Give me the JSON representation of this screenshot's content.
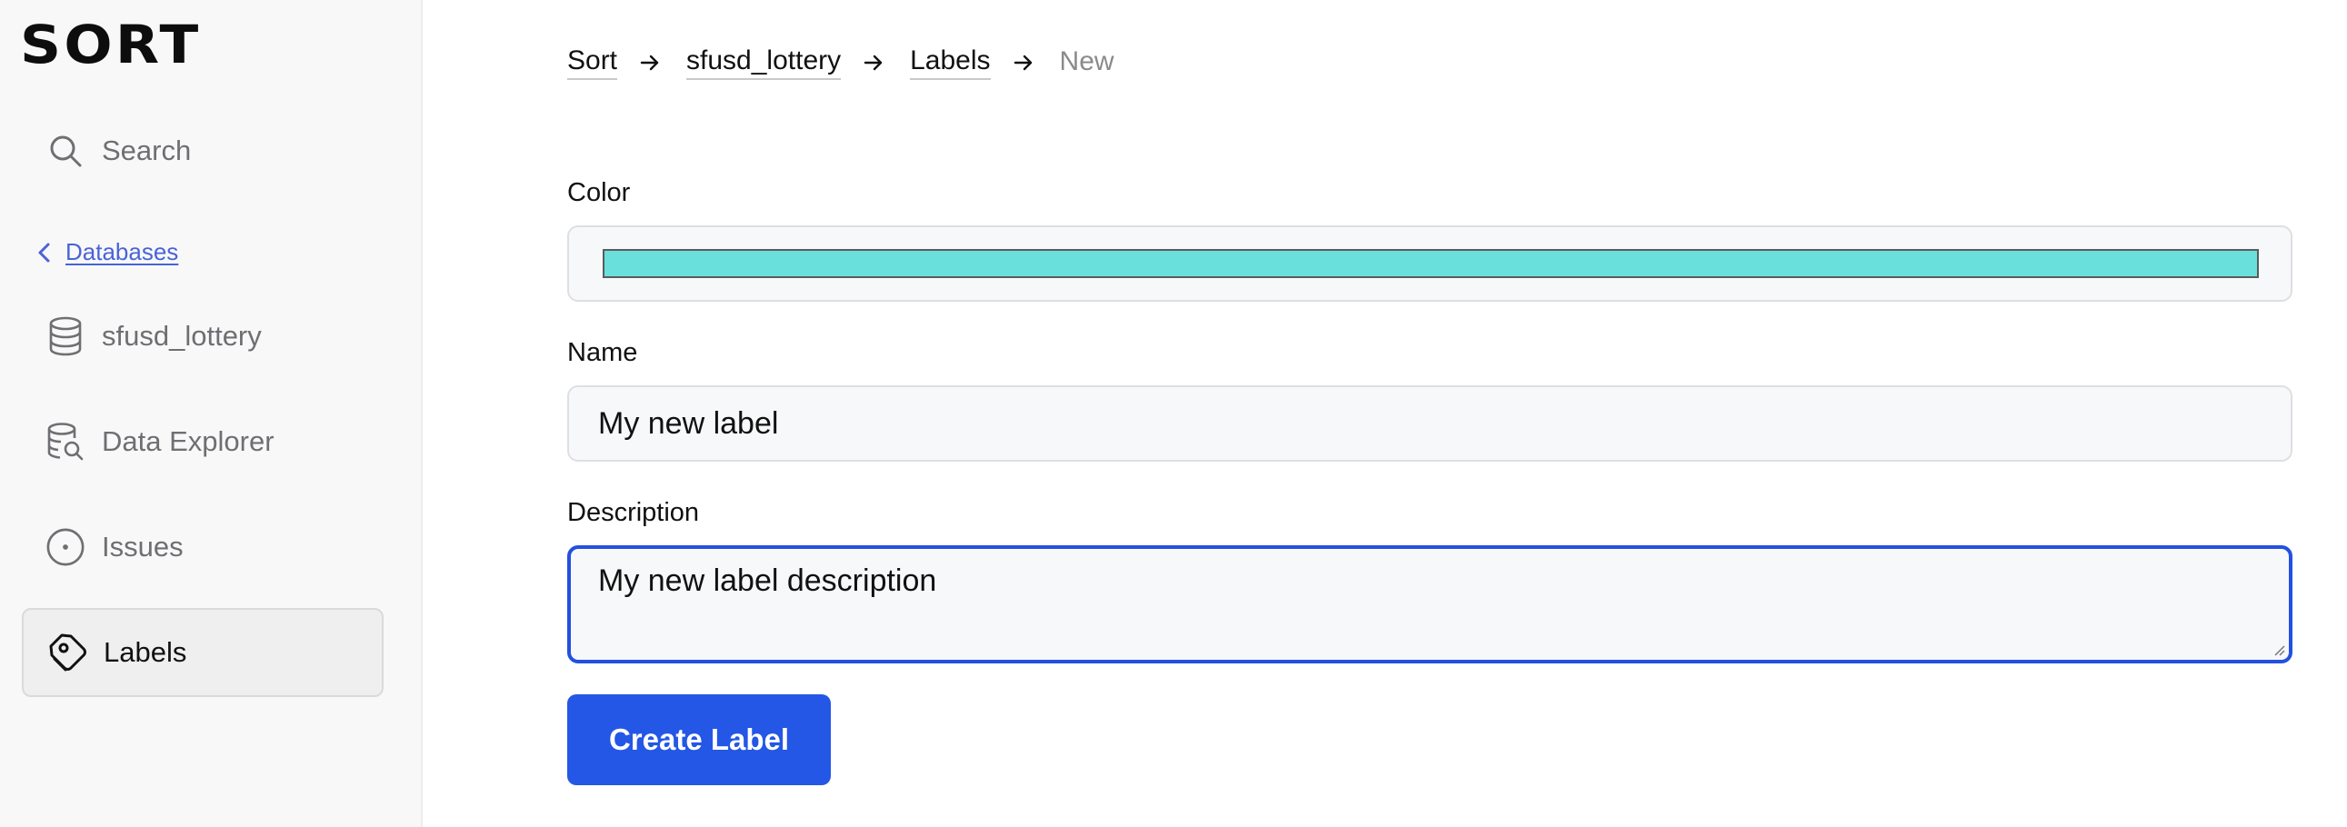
{
  "app": {
    "logo": "SORT"
  },
  "sidebar": {
    "search_label": "Search",
    "back_link": "Databases",
    "items": [
      {
        "label": "sfusd_lottery",
        "icon": "database-icon"
      },
      {
        "label": "Data Explorer",
        "icon": "database-search-icon"
      },
      {
        "label": "Issues",
        "icon": "issue-circle-icon"
      },
      {
        "label": "Labels",
        "icon": "tag-icon",
        "active": true
      }
    ]
  },
  "breadcrumb": {
    "items": [
      "Sort",
      "sfusd_lottery",
      "Labels"
    ],
    "current": "New"
  },
  "form": {
    "color_label": "Color",
    "color_value": "#6ae0dd",
    "name_label": "Name",
    "name_value": "My new label",
    "description_label": "Description",
    "description_value": "My new label description",
    "submit_label": "Create Label"
  },
  "colors": {
    "accent": "#2457e6",
    "focus_border": "#2450e0",
    "link": "#4a63d6"
  }
}
